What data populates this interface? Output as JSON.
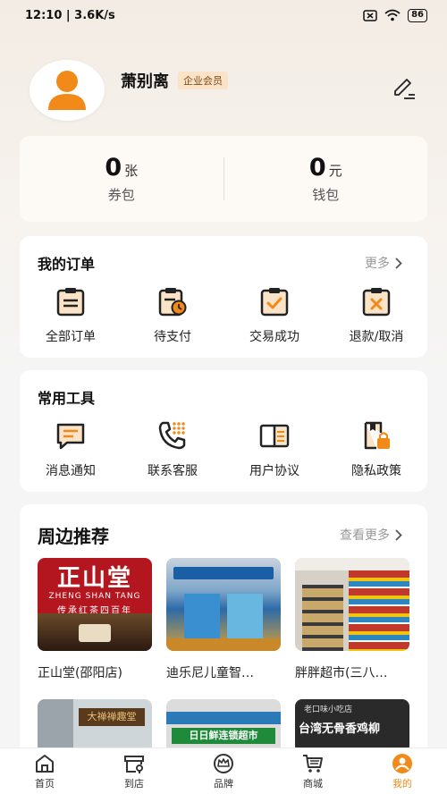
{
  "status_bar": {
    "time_speed": "12:10 | 3.6K/s",
    "battery": "86"
  },
  "profile": {
    "username": "萧别离",
    "badge": "企业会员"
  },
  "wallet": [
    {
      "value": "0",
      "unit": "张",
      "label": "券包"
    },
    {
      "value": "0",
      "unit": "元",
      "label": "钱包"
    }
  ],
  "orders": {
    "title": "我的订单",
    "more": "更多",
    "items": [
      {
        "label": "全部订单",
        "icon": "clipboard-list-icon"
      },
      {
        "label": "待支付",
        "icon": "pending-payment-icon"
      },
      {
        "label": "交易成功",
        "icon": "clipboard-check-icon"
      },
      {
        "label": "退款/取消",
        "icon": "clipboard-x-icon"
      }
    ]
  },
  "tools": {
    "title": "常用工具",
    "items": [
      {
        "label": "消息通知",
        "icon": "message-icon"
      },
      {
        "label": "联系客服",
        "icon": "phone-icon"
      },
      {
        "label": "用户协议",
        "icon": "book-icon"
      },
      {
        "label": "隐私政策",
        "icon": "lock-doc-icon"
      }
    ]
  },
  "nearby": {
    "title": "周边推荐",
    "more": "查看更多",
    "shops": [
      {
        "name": "正山堂(邵阳店)",
        "sign_title": "正山堂",
        "sign_sub": "ZHENG SHAN TANG",
        "sign_slogan": "传承红茶四百年"
      },
      {
        "name": "迪乐尼儿童智…"
      },
      {
        "name": "胖胖超市(三八…"
      },
      {
        "name": "",
        "sign_title": "大禅禅趣堂"
      },
      {
        "name": "",
        "sign_title": "日日鲜连锁超市"
      },
      {
        "name": "",
        "sign_title": "台湾无骨香鸡柳",
        "sign_sub": "老口味小吃店"
      }
    ]
  },
  "tabs": [
    {
      "label": "首页",
      "icon": "home-icon"
    },
    {
      "label": "到店",
      "icon": "store-icon"
    },
    {
      "label": "品牌",
      "icon": "crown-icon"
    },
    {
      "label": "商城",
      "icon": "cart-icon"
    },
    {
      "label": "我的",
      "icon": "user-icon"
    }
  ],
  "colors": {
    "accent": "#f28a1a",
    "badge_bg": "#fbe3c7"
  }
}
